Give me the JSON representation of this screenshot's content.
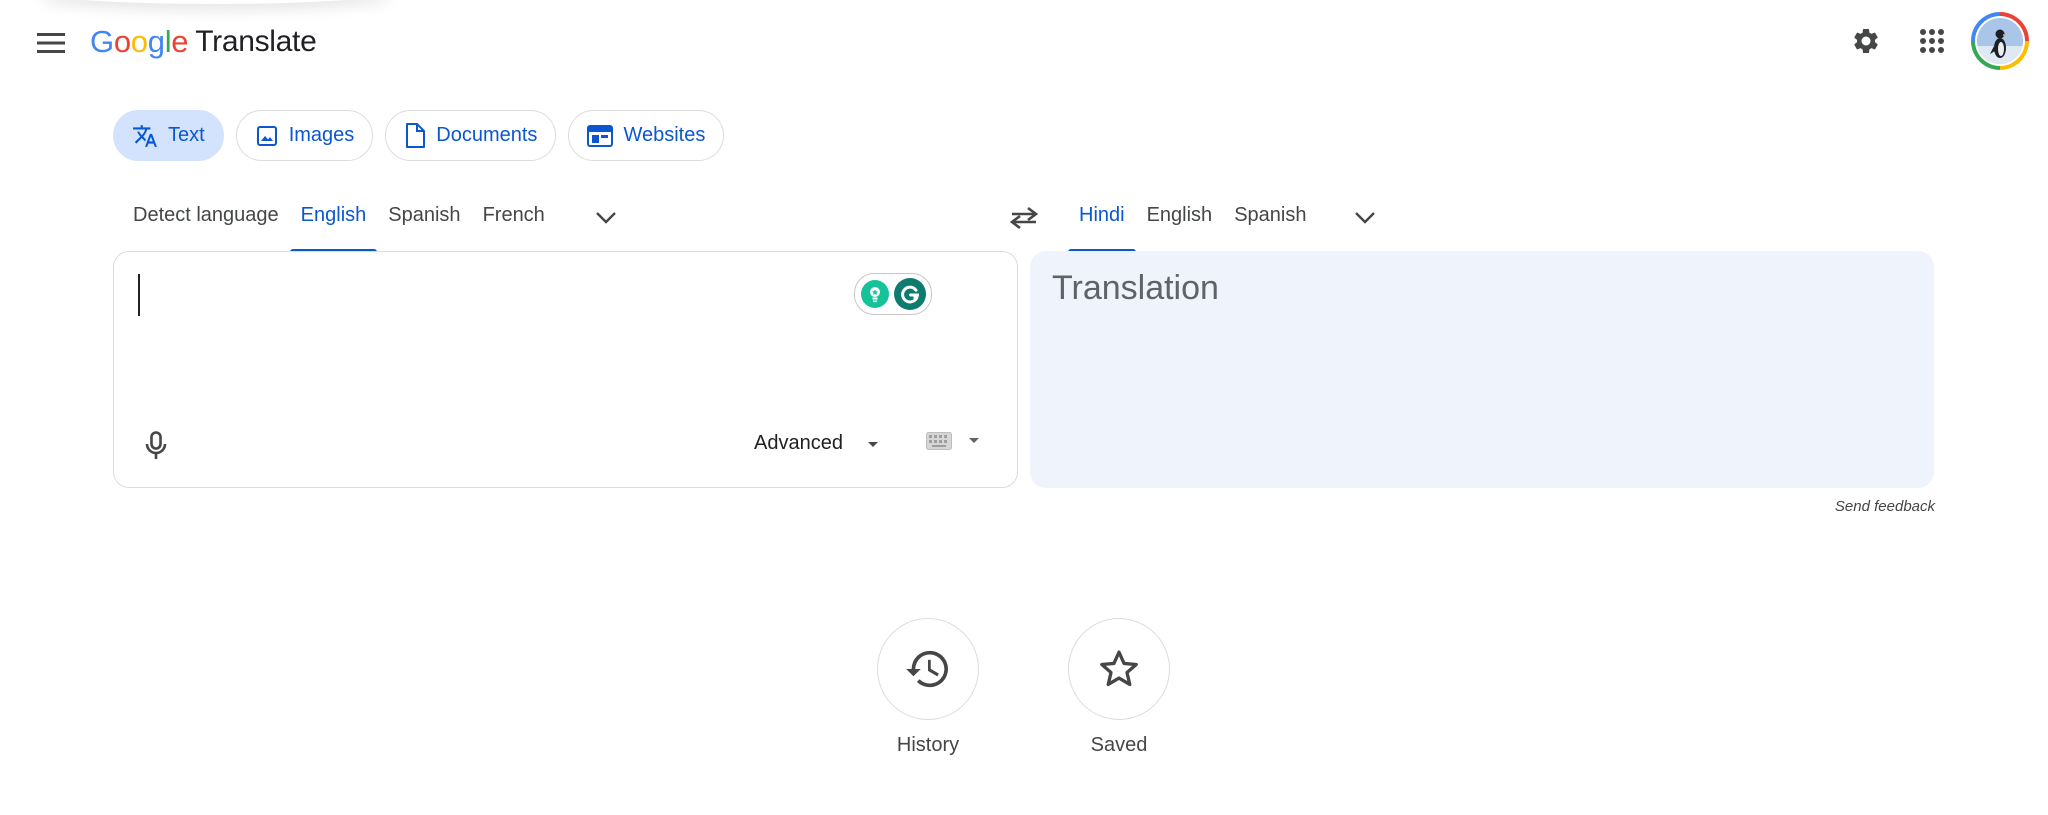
{
  "header": {
    "logo_letters": [
      {
        "ch": "G",
        "color": "#4285F4"
      },
      {
        "ch": "o",
        "color": "#EA4335"
      },
      {
        "ch": "o",
        "color": "#FBBC05"
      },
      {
        "ch": "g",
        "color": "#4285F4"
      },
      {
        "ch": "l",
        "color": "#34A853"
      },
      {
        "ch": "e",
        "color": "#EA4335"
      }
    ],
    "product_name": "Translate",
    "icons": {
      "menu": "hamburger-menu-icon",
      "settings": "gear-icon",
      "apps": "apps-grid-icon",
      "avatar": "account-avatar"
    }
  },
  "modes": [
    {
      "label": "Text",
      "icon": "translate-icon",
      "active": true
    },
    {
      "label": "Images",
      "icon": "image-icon",
      "active": false
    },
    {
      "label": "Documents",
      "icon": "document-icon",
      "active": false
    },
    {
      "label": "Websites",
      "icon": "website-icon",
      "active": false
    }
  ],
  "source_languages": {
    "tabs": [
      "Detect language",
      "English",
      "Spanish",
      "French"
    ],
    "active": "English"
  },
  "target_languages": {
    "tabs": [
      "Hindi",
      "English",
      "Spanish"
    ],
    "active": "Hindi"
  },
  "source_panel": {
    "input_value": "",
    "advanced_label": "Advanced",
    "icons": {
      "mic": "microphone-icon",
      "keyboard": "keyboard-icon",
      "grammarly": "grammarly-icon"
    }
  },
  "target_panel": {
    "placeholder": "Translation"
  },
  "feedback_label": "Send feedback",
  "shortcuts": {
    "history_label": "History",
    "saved_label": "Saved"
  },
  "colors": {
    "accent": "#0b57d0",
    "active_chip_bg": "#d3e3fd",
    "target_panel_bg": "#eff3fb"
  }
}
